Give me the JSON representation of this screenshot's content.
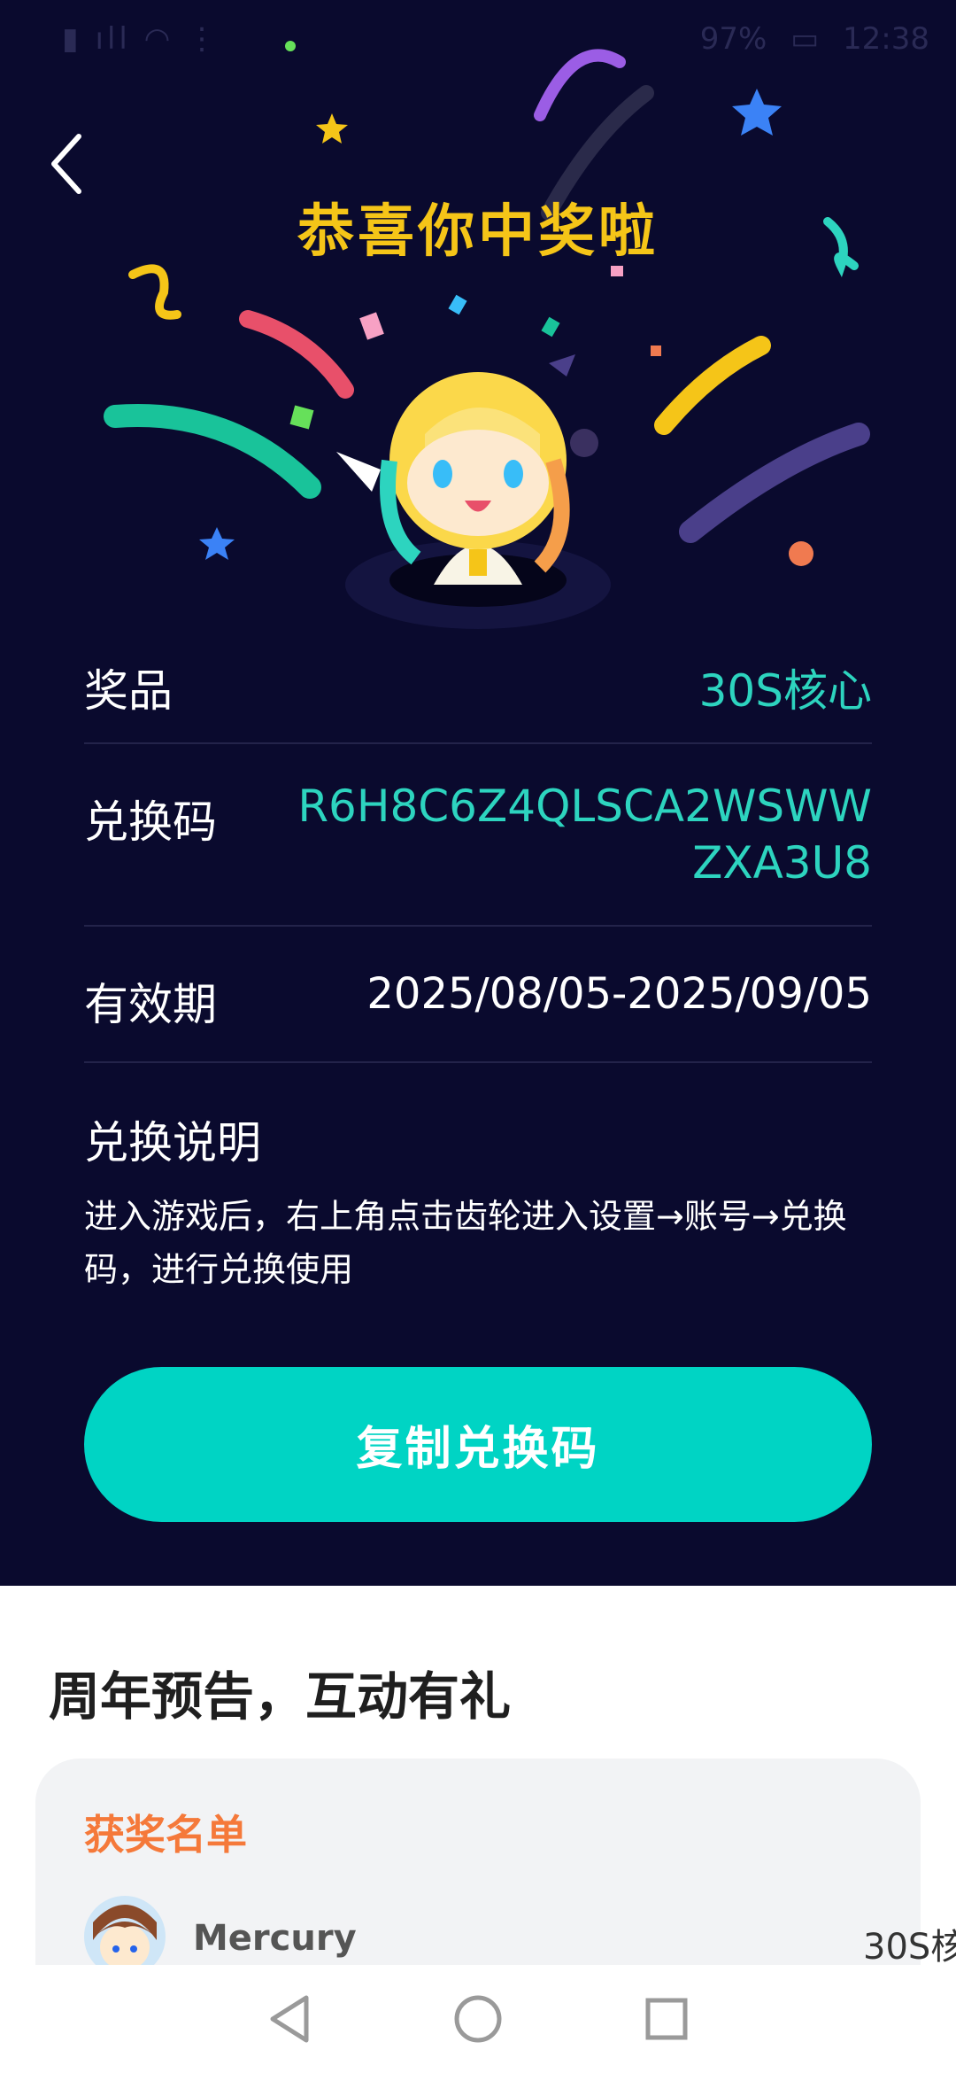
{
  "status_bar": {
    "left_icons": "sim-signal-wifi-icons",
    "battery": "97%",
    "time": "12:38"
  },
  "header": {
    "title": "恭喜你中奖啦"
  },
  "prize": {
    "label": "奖品",
    "value": "30S核心"
  },
  "code": {
    "label": "兑换码",
    "value": "R6H8C6Z4QLSCA2WSWWZXA3U8"
  },
  "validity": {
    "label": "有效期",
    "value": "2025/08/05-2025/09/05"
  },
  "instructions": {
    "heading": "兑换说明",
    "text": "进入游戏后，右上角点击齿轮进入设置→账号→兑换码，进行兑换使用"
  },
  "copy_button": {
    "label": "复制兑换码"
  },
  "section": {
    "title": "周年预告，互动有礼"
  },
  "winners": {
    "heading": "获奖名单",
    "items": [
      {
        "name": "Mercury",
        "prize": "30S核"
      }
    ]
  },
  "colors": {
    "background_dark": "#0a0a2e",
    "title_yellow": "#f5c518",
    "accent_teal": "#2dd4bf",
    "button_teal": "#00d4c4",
    "winners_orange": "#f5793a"
  },
  "icons": {
    "back": "chevron-left-icon",
    "nav_back": "triangle-back-icon",
    "nav_home": "circle-home-icon",
    "nav_recent": "square-recent-icon"
  }
}
